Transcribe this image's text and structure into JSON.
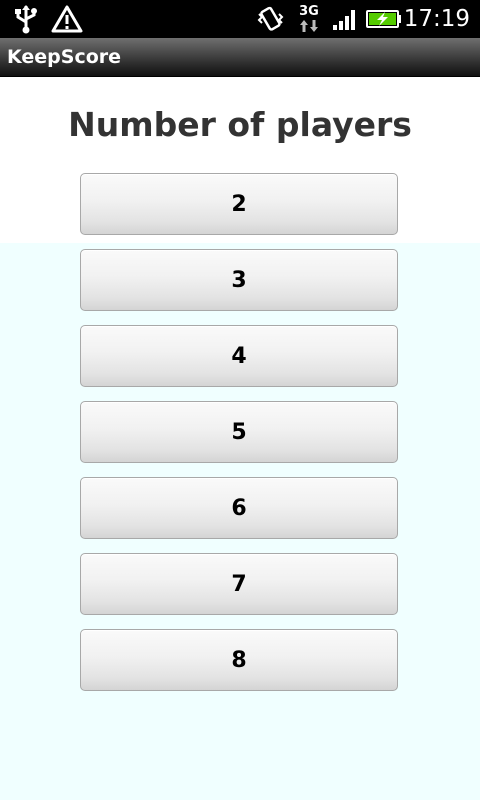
{
  "status_bar": {
    "time": "17:19",
    "network_label": "3G",
    "icons": [
      "usb-icon",
      "warning-icon",
      "vibrate-icon",
      "data-3g-icon",
      "signal-icon",
      "battery-charging-icon"
    ]
  },
  "app": {
    "title": "KeepScore"
  },
  "main": {
    "heading": "Number of players",
    "options": [
      "2",
      "3",
      "4",
      "5",
      "6",
      "7",
      "8"
    ]
  },
  "colors": {
    "status_bar": "#000000",
    "title_bar": "#3a3a3a",
    "background_top": "#ffffff",
    "background_bottom": "#f0ffff",
    "battery": "#55cc00"
  }
}
